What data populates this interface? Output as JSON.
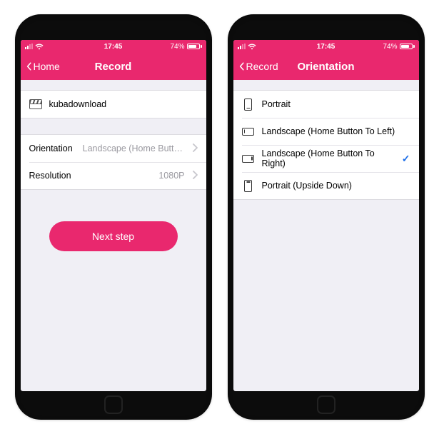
{
  "status_bar": {
    "time": "17:45",
    "battery_pct": "74%"
  },
  "phone_left": {
    "nav": {
      "back": "Home",
      "title": "Record"
    },
    "name_row": {
      "value": "kubadownload"
    },
    "orientation_row": {
      "label": "Orientation",
      "value": "Landscape (Home Button To Rig..."
    },
    "resolution_row": {
      "label": "Resolution",
      "value": "1080P"
    },
    "cta": "Next step"
  },
  "phone_right": {
    "nav": {
      "back": "Record",
      "title": "Orientation"
    },
    "options": [
      {
        "label": "Portrait",
        "selected": false
      },
      {
        "label": "Landscape (Home Button To Left)",
        "selected": false
      },
      {
        "label": "Landscape (Home Button To Right)",
        "selected": true
      },
      {
        "label": "Portrait (Upside Down)",
        "selected": false
      }
    ]
  }
}
